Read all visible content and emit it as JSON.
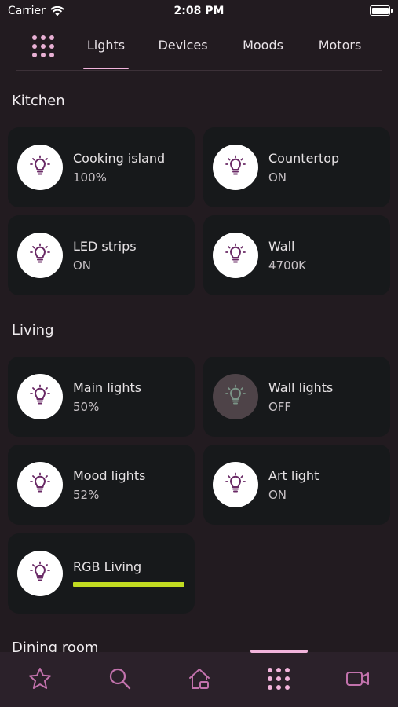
{
  "status_bar": {
    "carrier": "Carrier",
    "time": "2:08 PM"
  },
  "tabs": [
    {
      "label": "Lights",
      "active": true
    },
    {
      "label": "Devices",
      "active": false
    },
    {
      "label": "Moods",
      "active": false
    },
    {
      "label": "Motors",
      "active": false
    }
  ],
  "sections": [
    {
      "title": "Kitchen",
      "items": [
        {
          "name": "Cooking island",
          "state": "100%",
          "on": true
        },
        {
          "name": "Countertop",
          "state": "ON",
          "on": true
        },
        {
          "name": "LED strips",
          "state": "ON",
          "on": true
        },
        {
          "name": "Wall",
          "state": "4700K",
          "on": true
        }
      ]
    },
    {
      "title": "Living",
      "items": [
        {
          "name": "Main lights",
          "state": "50%",
          "on": true
        },
        {
          "name": "Wall lights",
          "state": "OFF",
          "on": false
        },
        {
          "name": "Mood lights",
          "state": "52%",
          "on": true
        },
        {
          "name": "Art light",
          "state": "ON",
          "on": true
        },
        {
          "name": "RGB Living",
          "state": "",
          "on": true,
          "rgb_color": "#c2dc21"
        }
      ]
    },
    {
      "title": "Dining room",
      "items": []
    }
  ],
  "bottom_nav": [
    {
      "icon": "star-icon",
      "active": false
    },
    {
      "icon": "search-icon",
      "active": false
    },
    {
      "icon": "home-icon",
      "active": false
    },
    {
      "icon": "grid-icon",
      "active": true
    },
    {
      "icon": "camera-icon",
      "active": false
    }
  ],
  "colors": {
    "background": "#221b20",
    "card": "#17191b",
    "accent": "#f2b4dc",
    "icon_purple": "#6a2a66",
    "rgb_bar": "#c2dc21"
  }
}
